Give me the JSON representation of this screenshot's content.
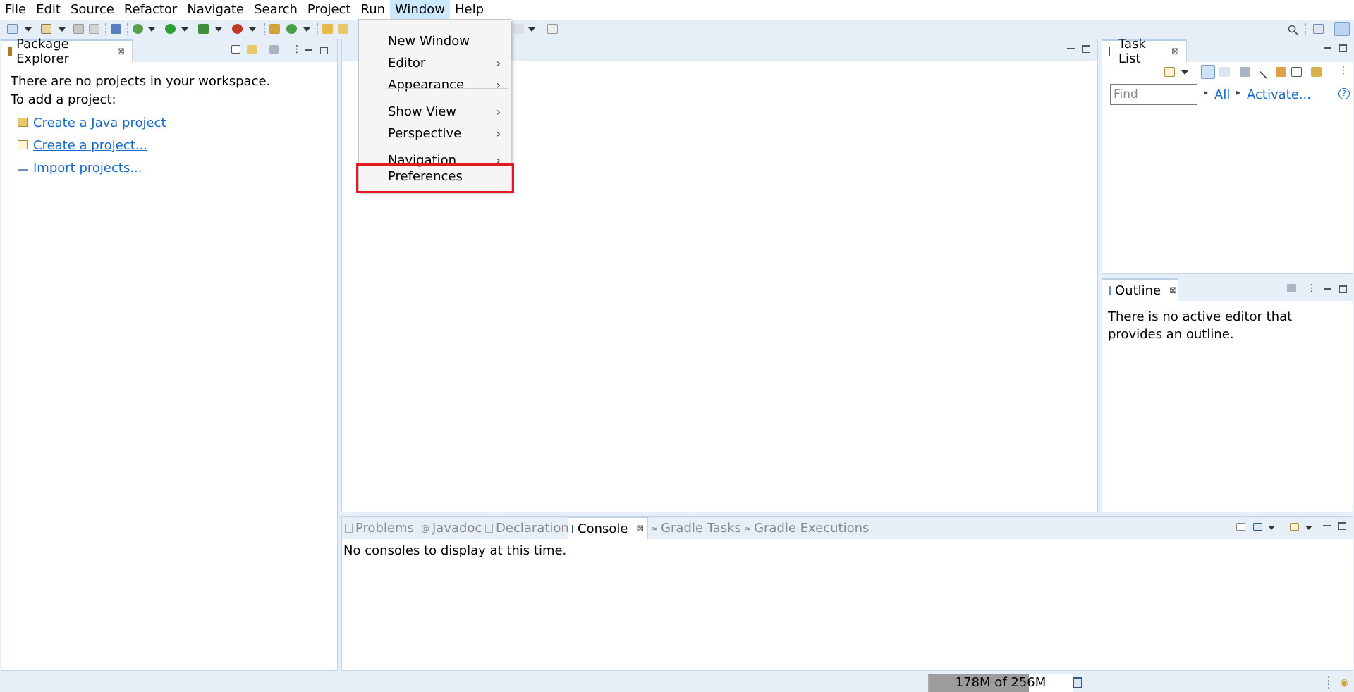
{
  "menubar": {
    "items": [
      "File",
      "Edit",
      "Source",
      "Refactor",
      "Navigate",
      "Search",
      "Project",
      "Run",
      "Window",
      "Help"
    ],
    "active": "Window"
  },
  "window_menu": {
    "items": [
      {
        "label": "New Window",
        "submenu": false
      },
      {
        "label": "Editor",
        "submenu": true
      },
      {
        "label": "Appearance",
        "submenu": true
      },
      {
        "label": "Show View",
        "submenu": true
      },
      {
        "label": "Perspective",
        "submenu": true
      },
      {
        "label": "Navigation",
        "submenu": true
      },
      {
        "label": "Preferences",
        "submenu": false
      }
    ],
    "highlighted": "Preferences",
    "highlight_color": "#e21a22"
  },
  "package_explorer": {
    "title": "Package Explorer",
    "message_line1": "There are no projects in your workspace.",
    "message_line2": "To add a project:",
    "links": [
      "Create a Java project",
      "Create a project...",
      "Import projects..."
    ]
  },
  "task_list": {
    "title": "Task List",
    "find_placeholder": "Find",
    "all_label": "All",
    "activate_label": "Activate...",
    "help_glyph": "?"
  },
  "outline": {
    "title": "Outline",
    "message": "There is no active editor that provides an outline."
  },
  "bottom_panel": {
    "tabs": [
      {
        "label": "Problems",
        "active": false,
        "icon": "problems-icon"
      },
      {
        "label": "Javadoc",
        "active": false,
        "icon": "javadoc-icon"
      },
      {
        "label": "Declaration",
        "active": false,
        "icon": "declaration-icon"
      },
      {
        "label": "Console",
        "active": true,
        "icon": "console-icon"
      },
      {
        "label": "Gradle Tasks",
        "active": false,
        "icon": "gradle-icon"
      },
      {
        "label": "Gradle Executions",
        "active": false,
        "icon": "gradle-icon"
      }
    ],
    "console_message": "No consoles to display at this time."
  },
  "status": {
    "heap": "178M of 256M",
    "heap_used_fraction": 0.695
  },
  "glyphs": {
    "close": "⊠",
    "submenu_arrow": "›",
    "triangle_right": "▸"
  },
  "colors": {
    "accent_link": "#1769c9",
    "menu_active_bg": "#cce8ff",
    "highlight_box": "#e21a22"
  }
}
